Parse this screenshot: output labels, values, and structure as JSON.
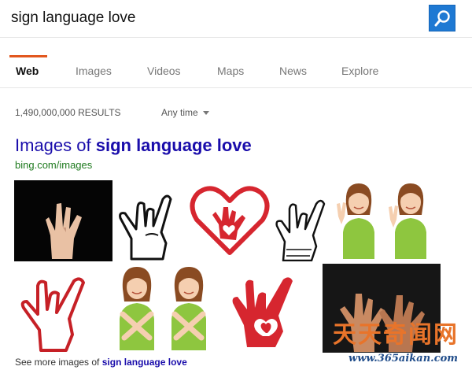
{
  "search": {
    "query": "sign language love",
    "button_icon": "search-icon"
  },
  "tabs": [
    {
      "label": "Web",
      "active": true
    },
    {
      "label": "Images",
      "active": false
    },
    {
      "label": "Videos",
      "active": false
    },
    {
      "label": "Maps",
      "active": false
    },
    {
      "label": "News",
      "active": false
    },
    {
      "label": "Explore",
      "active": false
    }
  ],
  "results": {
    "count_text": "1,490,000,000 RESULTS",
    "time_filter": "Any time"
  },
  "images_section": {
    "title_prefix": "Images of",
    "title_query": "sign language love",
    "source": "bing.com/images",
    "see_more_prefix": "See more images of",
    "see_more_query": "sign language love"
  },
  "watermark": {
    "chars": "天天奇闻网",
    "url": "www.365aikan.com"
  },
  "colors": {
    "accent": "#e2571e",
    "link": "#1a0dab",
    "url_green": "#1e7a1e",
    "search_button": "#1e79d3",
    "heart_red": "#d6262f",
    "shirt_green": "#8ec63f"
  }
}
